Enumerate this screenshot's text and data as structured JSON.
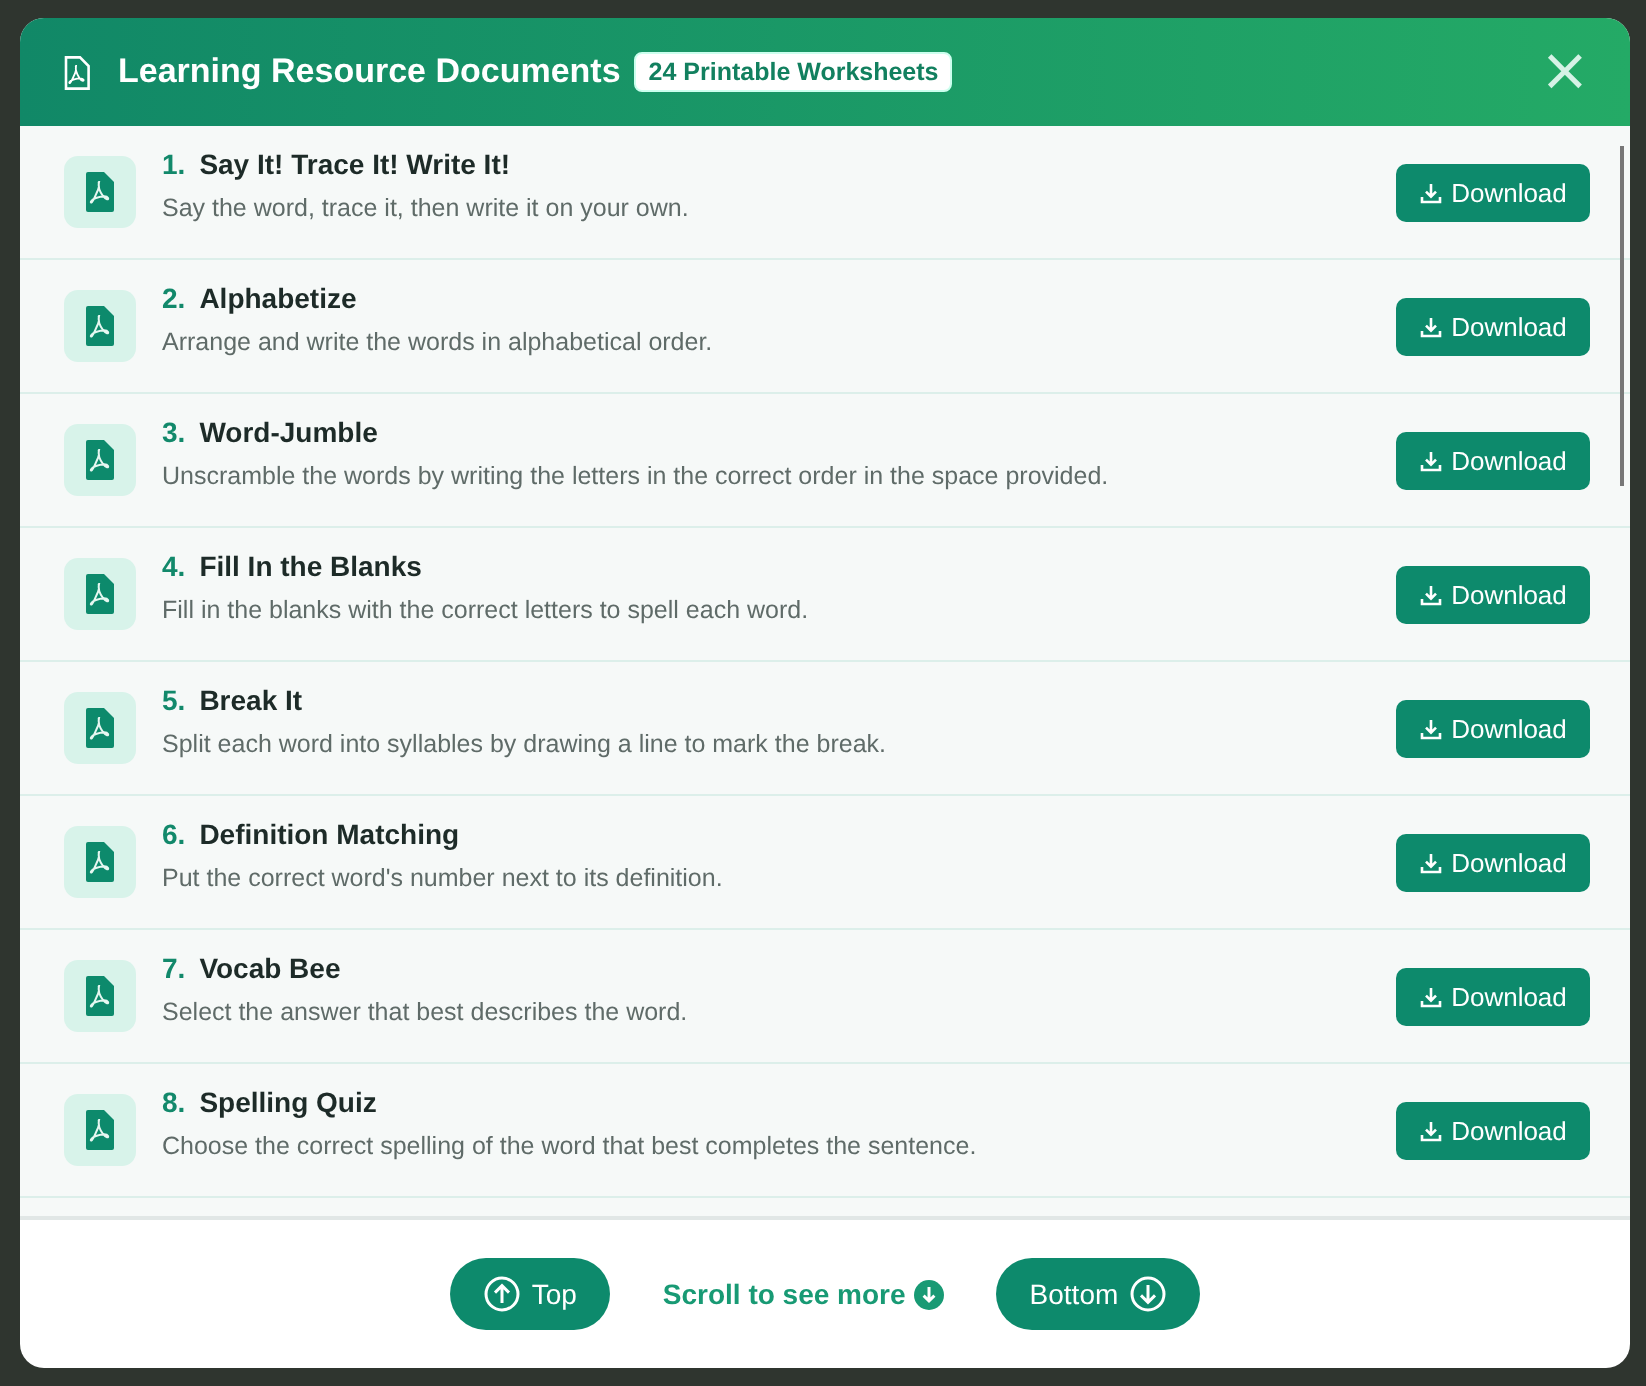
{
  "modal": {
    "title": "Learning Resource Documents",
    "badge": "24 Printable Worksheets",
    "close": "×"
  },
  "documents": [
    {
      "number": "1.",
      "title": "Say It! Trace It! Write It!",
      "description": "Say the word, trace it, then write it on your own.",
      "action": "Download"
    },
    {
      "number": "2.",
      "title": "Alphabetize",
      "description": "Arrange and write the words in alphabetical order.",
      "action": "Download"
    },
    {
      "number": "3.",
      "title": "Word-Jumble",
      "description": "Unscramble the words by writing the letters in the correct order in the space provided.",
      "action": "Download"
    },
    {
      "number": "4.",
      "title": "Fill In the Blanks",
      "description": "Fill in the blanks with the correct letters to spell each word.",
      "action": "Download"
    },
    {
      "number": "5.",
      "title": "Break It",
      "description": "Split each word into syllables by drawing a line to mark the break.",
      "action": "Download"
    },
    {
      "number": "6.",
      "title": "Definition Matching",
      "description": "Put the correct word's number next to its definition.",
      "action": "Download"
    },
    {
      "number": "7.",
      "title": "Vocab Bee",
      "description": "Select the answer that best describes the word.",
      "action": "Download"
    },
    {
      "number": "8.",
      "title": "Spelling Quiz",
      "description": "Choose the correct spelling of the word that best completes the sentence.",
      "action": "Download"
    }
  ],
  "footer": {
    "top": "Top",
    "hint": "Scroll to see more",
    "bottom": "Bottom"
  }
}
